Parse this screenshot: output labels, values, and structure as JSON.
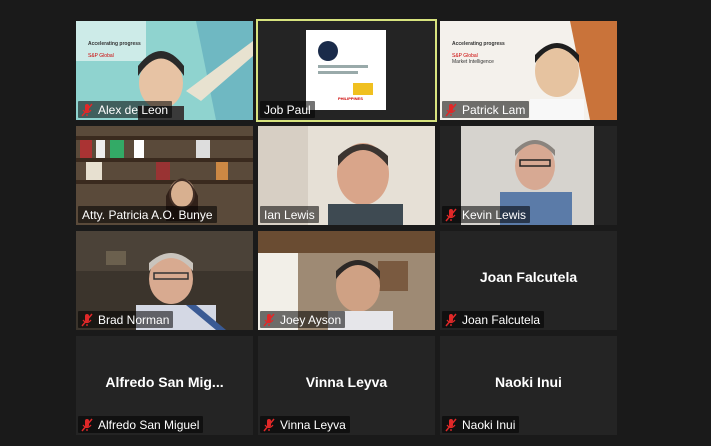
{
  "participants": [
    {
      "name": "Alex de Leon",
      "muted": true,
      "slide": {
        "line1": "Accelerating progress",
        "line2": "S&P Global"
      }
    },
    {
      "name": "Job Paul",
      "muted": false,
      "logo_text": "PHILIPPINES"
    },
    {
      "name": "Patrick Lam",
      "muted": true,
      "slide": {
        "line1": "Accelerating progress",
        "line2": "S&P Global",
        "line3": "Market Intelligence"
      }
    },
    {
      "name": "Atty. Patricia A.O. Bunye",
      "muted": false
    },
    {
      "name": "Ian Lewis",
      "muted": false
    },
    {
      "name": "Kevin Lewis",
      "muted": true
    },
    {
      "name": "Brad Norman",
      "muted": true
    },
    {
      "name": "Joey Ayson",
      "muted": true
    },
    {
      "name": "Joan Falcutela",
      "muted": true,
      "display_name": "Joan Falcutela"
    },
    {
      "name": "Alfredo San Miguel",
      "muted": true,
      "display_name": "Alfredo San Mig..."
    },
    {
      "name": "Vinna Leyva",
      "muted": true,
      "display_name": "Vinna Leyva"
    },
    {
      "name": "Naoki Inui",
      "muted": true,
      "display_name": "Naoki Inui"
    }
  ],
  "colors": {
    "muted_mic": "#e02828",
    "active_border": "#d7e37e"
  }
}
